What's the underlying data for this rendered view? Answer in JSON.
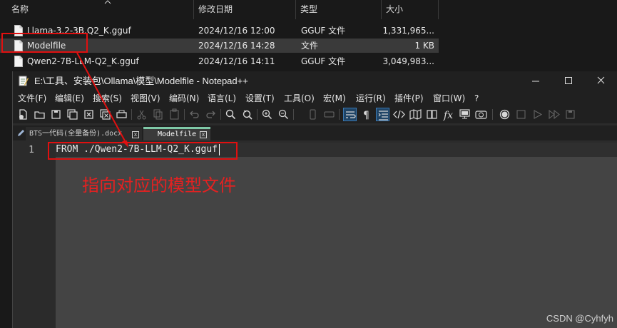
{
  "explorer": {
    "columns": [
      "名称",
      "修改日期",
      "类型",
      "大小"
    ],
    "files": [
      {
        "name": "Llama-3.2-3B.Q2_K.gguf",
        "modified": "2024/12/16 12:00",
        "type": "GGUF 文件",
        "size": "1,331,965..."
      },
      {
        "name": "Modelfile",
        "modified": "2024/12/16 14:28",
        "type": "文件",
        "size": "1 KB"
      },
      {
        "name": "Qwen2-7B-LLM-Q2_K.gguf",
        "modified": "2024/12/16 14:11",
        "type": "GGUF 文件",
        "size": "3,049,983..."
      }
    ]
  },
  "notepad": {
    "title": "E:\\工具、安装包\\Ollama\\模型\\Modelfile - Notepad++",
    "menu": [
      "文件(F)",
      "编辑(E)",
      "搜索(S)",
      "视图(V)",
      "编码(N)",
      "语言(L)",
      "设置(T)",
      "工具(O)",
      "宏(M)",
      "运行(R)",
      "插件(P)",
      "窗口(W)",
      "?"
    ],
    "tabs": [
      {
        "label": "BTS一代码(全量备份).docx",
        "active": false
      },
      {
        "label": "Modelfile",
        "active": true
      }
    ],
    "line_number": "1",
    "code_line": "FROM ./Qwen2-7B-LLM-Q2_K.gguf"
  },
  "annotation": {
    "text": "指向对应的模型文件",
    "color": "#e01010"
  },
  "watermark": "CSDN @Cyhfyh",
  "colors": {
    "tab_accent": "#7fc9a7",
    "toolbar_active": "#1f4466"
  },
  "icons": [
    "file-icon",
    "notepad-icon",
    "minimize-icon",
    "maximize-icon",
    "close-icon",
    "pencil-icon"
  ]
}
